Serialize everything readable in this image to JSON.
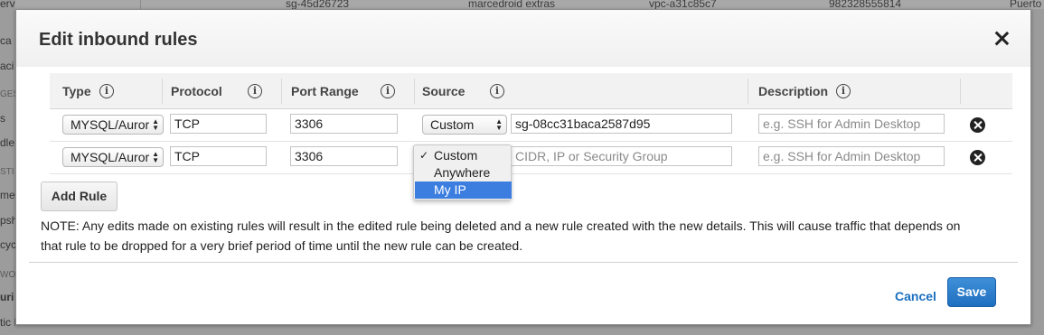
{
  "background": {
    "top_row": [
      "sg-45d26723",
      "marcedroid extras",
      "vpc-a31c85c7",
      "982328555814",
      "Puerto"
    ],
    "left_fragments": [
      "erv",
      "ca",
      "aci",
      "GES",
      "s",
      "dle",
      "STI",
      "me",
      "psh",
      "cyc",
      "WO",
      "uri",
      "tic I"
    ]
  },
  "modal": {
    "title": "Edit inbound rules",
    "columns": {
      "type": "Type",
      "protocol": "Protocol",
      "port_range": "Port Range",
      "source": "Source",
      "description": "Description"
    },
    "info_glyph": "i",
    "rows": [
      {
        "type": "MYSQL/Auror",
        "protocol": "TCP",
        "port_range": "3306",
        "source_select": "Custom",
        "source_value": "sg-08cc31baca2587d95",
        "description_placeholder": "e.g. SSH for Admin Desktop"
      },
      {
        "type": "MYSQL/Auror",
        "protocol": "TCP",
        "port_range": "3306",
        "source_placeholder": "CIDR, IP or Security Group",
        "description_placeholder": "e.g. SSH for Admin Desktop"
      }
    ],
    "source_dropdown": {
      "options": [
        "Custom",
        "Anywhere",
        "My IP"
      ],
      "checked": "Custom",
      "highlighted": "My IP"
    },
    "add_rule_label": "Add Rule",
    "note": "NOTE: Any edits made on existing rules will result in the edited rule being deleted and a new rule created with the new details. This will cause traffic that depends on that rule to be dropped for a very brief period of time until the new rule can be created.",
    "cancel_label": "Cancel",
    "save_label": "Save"
  },
  "colors": {
    "primary_button": "#1f6fc1",
    "link": "#1a6fc0",
    "dropdown_highlight": "#3b7ee0"
  }
}
